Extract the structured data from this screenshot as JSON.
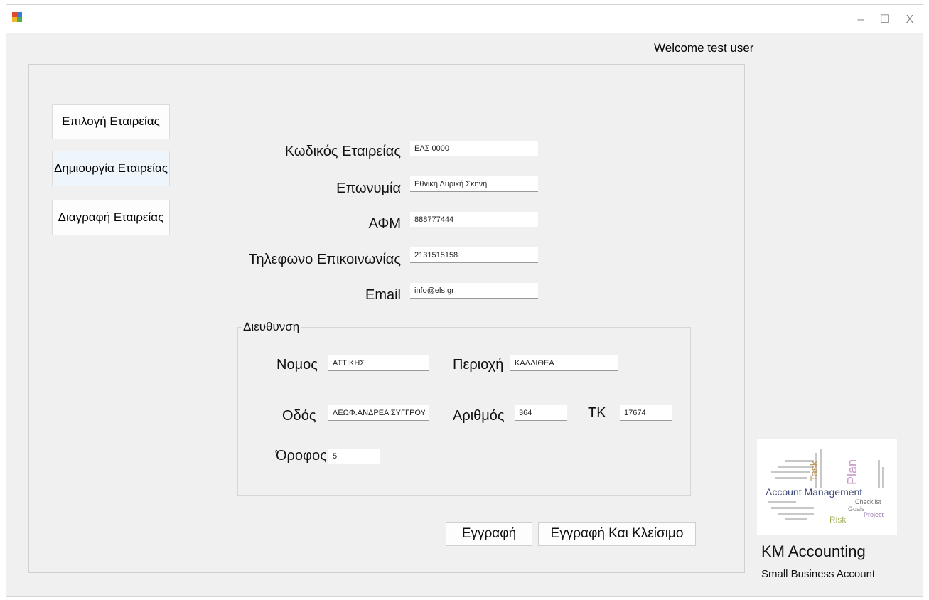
{
  "window": {
    "minimize_glyph": "–",
    "maximize_glyph": "☐",
    "close_glyph": "X"
  },
  "header": {
    "welcome": "Welcome test user"
  },
  "sidebar": {
    "items": [
      {
        "label": "Επιλογή Εταιρείας"
      },
      {
        "label": "Δημιουργία Εταιρείας"
      },
      {
        "label": "Διαγραφή Εταιρείας"
      }
    ]
  },
  "form": {
    "company_code": {
      "label": "Κωδικός Εταιρείας",
      "value": "ΕΛΣ 0000"
    },
    "name": {
      "label": "Επωνυμία",
      "value": "Εθνική Λυρική Σκηνή"
    },
    "afm": {
      "label": "ΑΦΜ",
      "value": "888777444"
    },
    "phone": {
      "label": "Τηλεφωνο Επικοινωνίας",
      "value": "2131515158"
    },
    "email": {
      "label": "Email",
      "value": "info@els.gr"
    }
  },
  "address": {
    "title": "Διευθυνση",
    "nomos": {
      "label": "Νομος",
      "value": "ΑΤΤΙΚΗΣ"
    },
    "perioxi": {
      "label": "Περιοχή",
      "value": "ΚΑΛΛΙΘΕΑ"
    },
    "odos": {
      "label": "Οδός",
      "value": "ΛΕΩΦ.ΑΝΔΡΕΑ ΣΥΓΓΡΟΥ"
    },
    "arithmos": {
      "label": "Αριθμός",
      "value": "364"
    },
    "tk": {
      "label": "ΤΚ",
      "value": "17674"
    },
    "orofos": {
      "label": "Όροφος",
      "value": "5"
    }
  },
  "actions": {
    "save": "Εγγραφή",
    "save_close": "Εγγραφή Και Κλείσιμο"
  },
  "brand": {
    "logo_words": {
      "main": "Account Management",
      "w1": "Task",
      "w2": "Plan",
      "w3": "Checklist",
      "w4": "Goals",
      "w5": "Project",
      "w6": "Risk"
    },
    "title": "KM Accounting",
    "subtitle": "Small Business Account"
  }
}
